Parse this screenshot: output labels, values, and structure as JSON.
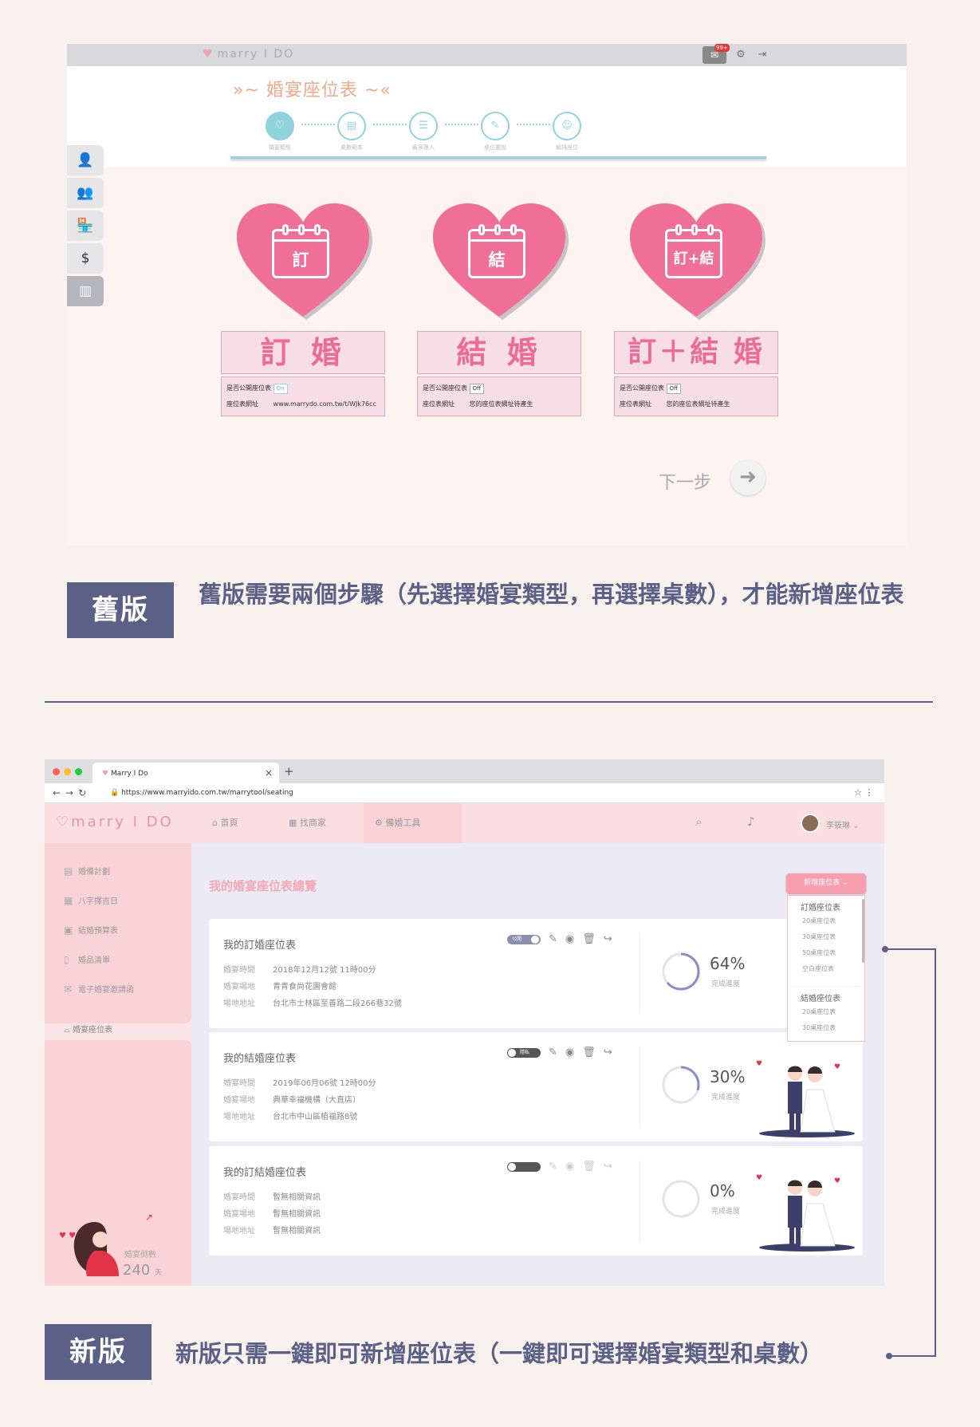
{
  "old_version": {
    "topbar": {
      "logo_text": "marry I DO",
      "badge": "99+"
    },
    "title": "婚宴座位表",
    "steps": [
      "婚宴類型",
      "桌數範本",
      "賓客匯入",
      "桌位擺設",
      "編排座位"
    ],
    "side_icons": [
      "user-icon",
      "users-icon",
      "shop-icon",
      "money-bag-icon",
      "clipboard-icon"
    ],
    "types": [
      {
        "calendar_label": "訂",
        "name": "訂 婚",
        "public_label": "是否公開座位表",
        "toggle": "On",
        "url_label": "座位表網址",
        "url_value": "www.marrydo.com.tw/t/WJk76cc"
      },
      {
        "calendar_label": "結",
        "name": "結 婚",
        "public_label": "是否公開座位表",
        "toggle": "Off",
        "url_label": "座位表網址",
        "url_value": "您的座位表網址待產生"
      },
      {
        "calendar_label": "訂+結",
        "name": "訂＋結 婚",
        "public_label": "是否公開座位表",
        "toggle": "Off",
        "url_label": "座位表網址",
        "url_value": "您的座位表網址待產生"
      }
    ],
    "next_label": "下一步",
    "tag": "舊版",
    "description": "舊版需要兩個步驟（先選擇婚宴類型，再選擇桌數），才能新增座位表"
  },
  "new_version": {
    "browser": {
      "tab_title": "Marry I Do",
      "url": "https://www.marryido.com.tw/marrytool/seating"
    },
    "nav": {
      "logo": "marry I DO",
      "home": "首頁",
      "vendor": "找商家",
      "tools": "備婚工具",
      "username": "李筱琳"
    },
    "sidebar": {
      "items": [
        "婚備計劃",
        "八字擇吉日",
        "結婚預算表",
        "婚品清單",
        "電子婚宴邀請函"
      ],
      "active": "婚宴座位表",
      "countdown_label": "婚宴倒數",
      "countdown_value": "240",
      "countdown_unit": "天"
    },
    "main_title": "我的婚宴座位表總覽",
    "add_button": "新增座位表",
    "dropdown": {
      "groups": [
        {
          "header": "訂婚座位表",
          "items": [
            "20桌座位表",
            "30桌座位表",
            "50桌座位表",
            "空白座位表"
          ]
        },
        {
          "header": "結婚座位表",
          "items": [
            "20桌座位表",
            "30桌座位表"
          ]
        }
      ]
    },
    "cards": [
      {
        "title": "我的訂婚座位表",
        "toggle": "公開",
        "time_label": "婚宴時間",
        "time": "2018年12月12號 11時00分",
        "venue_label": "婚宴場地",
        "venue": "青青食尚花園會館",
        "address_label": "場地地址",
        "address": "台北市士林區至善路二段266巷32號",
        "progress": 64,
        "progress_text": "64%",
        "progress_label": "完成進度"
      },
      {
        "title": "我的結婚座位表",
        "toggle": "隱私",
        "time_label": "婚宴時間",
        "time": "2019年06月06號 12時00分",
        "venue_label": "婚宴場地",
        "venue": "典華幸福機構（大直店）",
        "address_label": "場地地址",
        "address": "台北市中山區植福路8號",
        "progress": 30,
        "progress_text": "30%",
        "progress_label": "完成進度"
      },
      {
        "title": "我的訂結婚座位表",
        "toggle": "",
        "time_label": "婚宴時間",
        "time": "暫無相關資訊",
        "venue_label": "婚宴場地",
        "venue": "暫無相關資訊",
        "address_label": "場地地址",
        "address": "暫無相關資訊",
        "progress": 0,
        "progress_text": "0%",
        "progress_label": "完成進度"
      }
    ],
    "tag": "新版",
    "description": "新版只需一鍵即可新增座位表（一鍵即可選擇婚宴類型和桌數）"
  },
  "colors": {
    "accent_pink": "#ec6c97",
    "label_navy": "#5b6186",
    "nav_pink": "#fbdedf",
    "ring_blue": "#8a8fc0"
  }
}
